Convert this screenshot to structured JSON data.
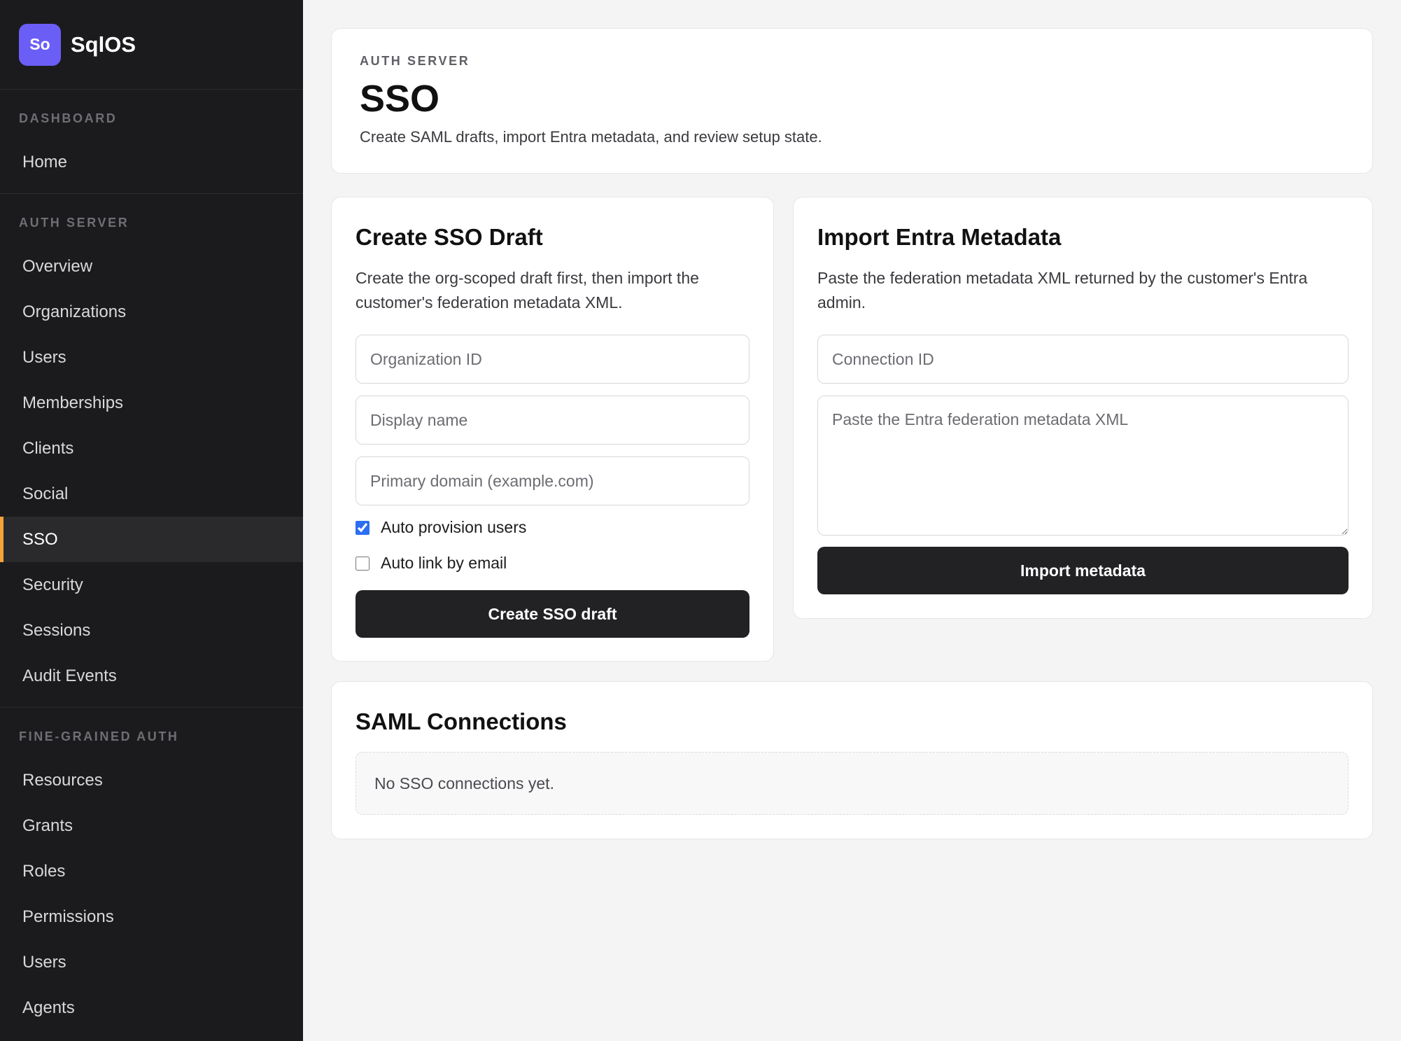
{
  "brand": {
    "logo": "So",
    "name": "SqlOS"
  },
  "sidebar": {
    "sections": [
      {
        "title": "DASHBOARD",
        "items": [
          "Home"
        ]
      },
      {
        "title": "AUTH SERVER",
        "items": [
          "Overview",
          "Organizations",
          "Users",
          "Memberships",
          "Clients",
          "Social",
          "SSO",
          "Security",
          "Sessions",
          "Audit Events"
        ]
      },
      {
        "title": "FINE-GRAINED AUTH",
        "items": [
          "Resources",
          "Grants",
          "Roles",
          "Permissions",
          "Users",
          "Agents"
        ]
      }
    ],
    "active_item": "SSO",
    "accent_color": "#f3a33a"
  },
  "header": {
    "eyebrow": "AUTH SERVER",
    "title": "SSO",
    "subtitle": "Create SAML drafts, import Entra metadata, and review setup state."
  },
  "create_draft": {
    "title": "Create SSO Draft",
    "description": "Create the org-scoped draft first, then import the customer's federation metadata XML.",
    "org_id_placeholder": "Organization ID",
    "display_name_placeholder": "Display name",
    "domain_placeholder": "Primary domain (example.com)",
    "auto_provision_label": "Auto provision users",
    "auto_provision_checked": true,
    "auto_link_label": "Auto link by email",
    "auto_link_checked": false,
    "button_label": "Create SSO draft"
  },
  "import_metadata": {
    "title": "Import Entra Metadata",
    "description": "Paste the federation metadata XML returned by the customer's Entra admin.",
    "connection_id_placeholder": "Connection ID",
    "xml_placeholder": "Paste the Entra federation metadata XML",
    "button_label": "Import metadata"
  },
  "connections": {
    "title": "SAML Connections",
    "empty_text": "No SSO connections yet."
  }
}
